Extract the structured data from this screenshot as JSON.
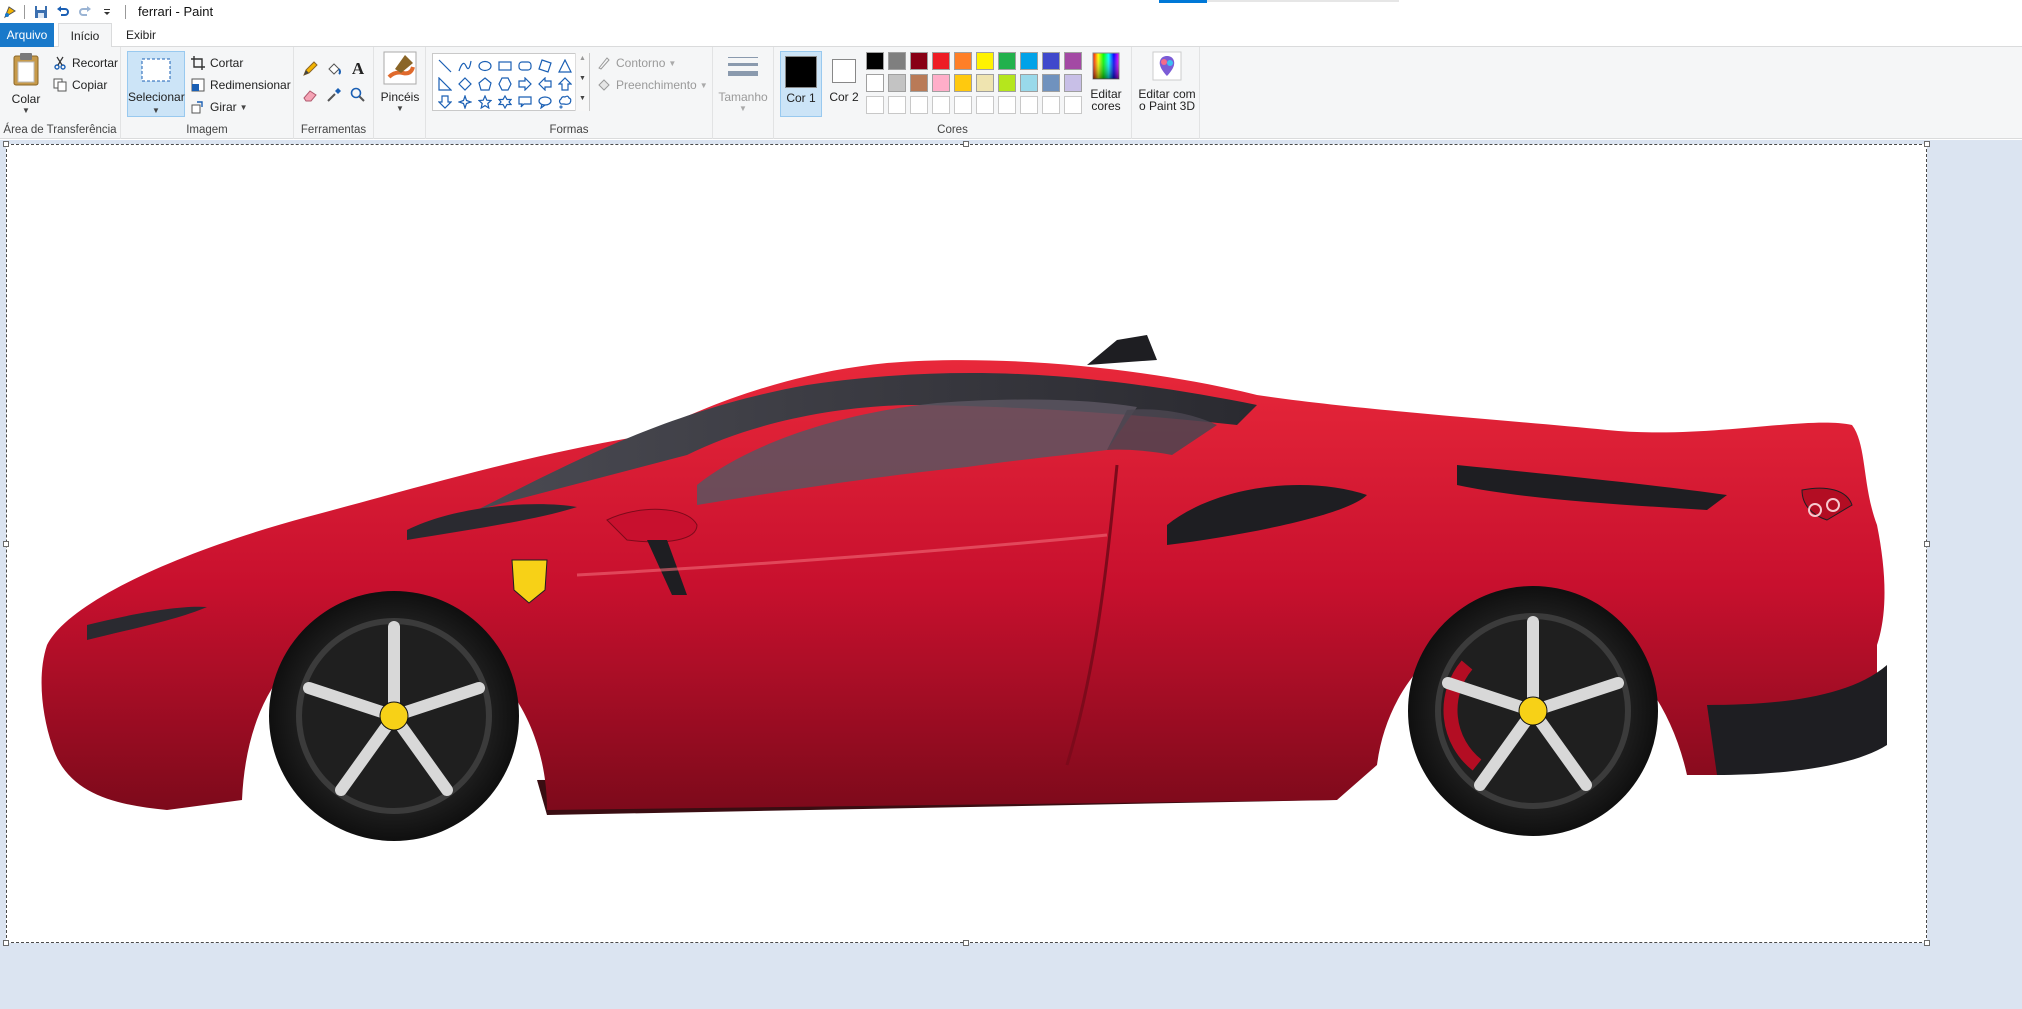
{
  "window": {
    "title": "ferrari - Paint"
  },
  "tabs": [
    {
      "label": "Arquivo"
    },
    {
      "label": "Início"
    },
    {
      "label": "Exibir"
    }
  ],
  "clipboard": {
    "paste_label": "Colar",
    "cut_label": "Recortar",
    "copy_label": "Copiar",
    "group_label": "Área de Transferência"
  },
  "image": {
    "select_label": "Selecionar",
    "crop_label": "Cortar",
    "resize_label": "Redimensionar",
    "rotate_label": "Girar",
    "group_label": "Imagem"
  },
  "tools": {
    "group_label": "Ferramentas",
    "items": [
      "pencil-icon",
      "fill-icon",
      "text-icon",
      "eraser-icon",
      "color-picker-icon",
      "magnifier-icon"
    ]
  },
  "brushes": {
    "label": "Pincéis"
  },
  "shapes": {
    "outline_label": "Contorno",
    "fill_label": "Preenchimento",
    "group_label": "Formas"
  },
  "size": {
    "label": "Tamanho"
  },
  "colors": {
    "color1_label": "Cor 1",
    "color2_label": "Cor 2",
    "edit_label": "Editar cores",
    "group_label": "Cores",
    "color1": "#000000",
    "color2": "#ffffff",
    "palette_row1": [
      "#000000",
      "#7f7f7f",
      "#880015",
      "#ed1c24",
      "#ff7f27",
      "#fff200",
      "#22b14c",
      "#00a2e8",
      "#3f48cc",
      "#a349a4"
    ],
    "palette_row2": [
      "#ffffff",
      "#c3c3c3",
      "#b97a57",
      "#ffaec9",
      "#ffc90e",
      "#efe4b0",
      "#b5e61d",
      "#99d9ea",
      "#7092be",
      "#c8bfe7"
    ],
    "palette_row3": [
      "#ffffff",
      "#ffffff",
      "#ffffff",
      "#ffffff",
      "#ffffff",
      "#ffffff",
      "#ffffff",
      "#ffffff",
      "#ffffff",
      "#ffffff"
    ]
  },
  "paint3d": {
    "label": "Editar com o Paint 3D"
  },
  "canvas": {
    "image_subject": "red-sports-car-image",
    "body_color": "#c8102e",
    "roof_color": "#3a3a3f",
    "workspace_color": "#dbe4f1"
  }
}
